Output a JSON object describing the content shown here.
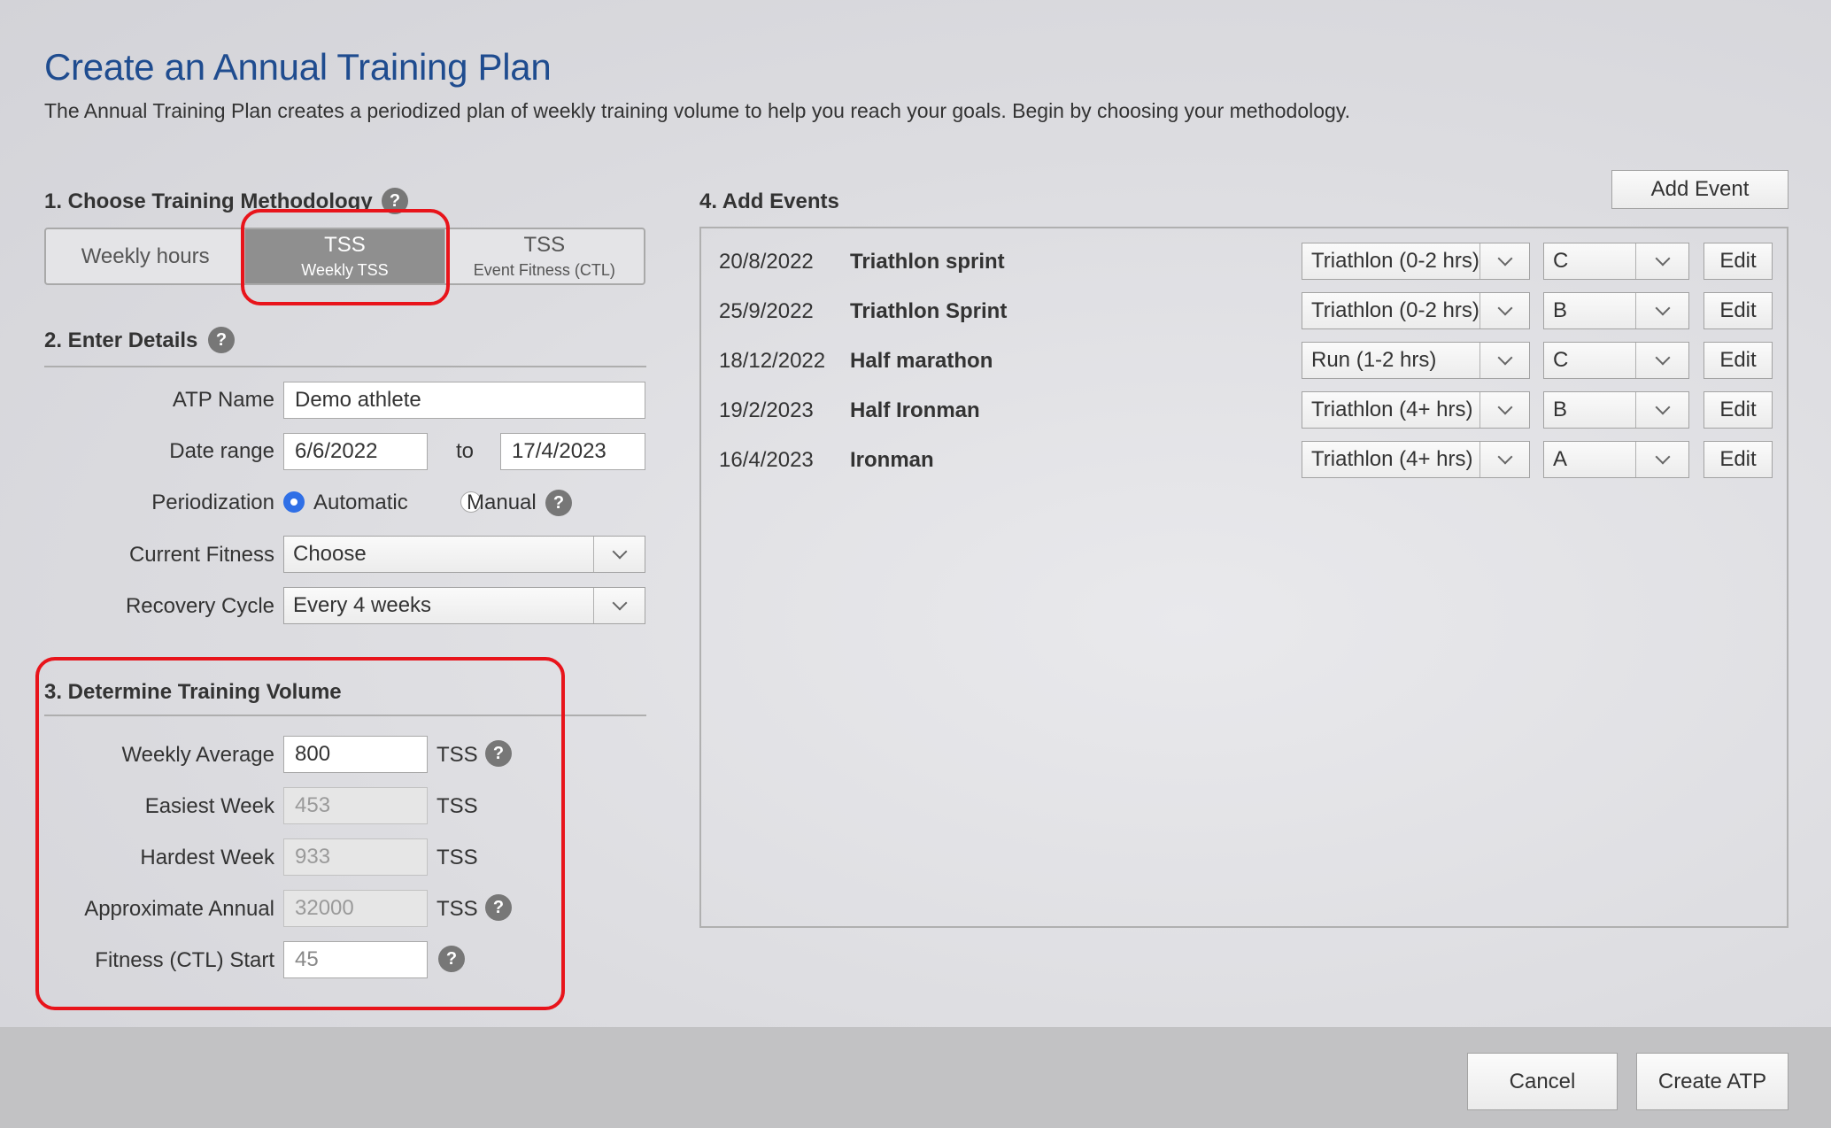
{
  "header": {
    "title": "Create an Annual Training Plan",
    "subtitle": "The Annual Training Plan creates a periodized plan of weekly training volume to help you reach your goals. Begin by choosing your methodology."
  },
  "methodology": {
    "heading": "1. Choose Training Methodology",
    "options": [
      {
        "main": "Weekly hours",
        "sub": "",
        "active": false
      },
      {
        "main": "TSS",
        "sub": "Weekly TSS",
        "active": true
      },
      {
        "main": "TSS",
        "sub": "Event Fitness (CTL)",
        "active": false
      }
    ]
  },
  "details": {
    "heading": "2. Enter Details",
    "atp_name_label": "ATP Name",
    "atp_name_value": "Demo athlete",
    "date_range_label": "Date range",
    "date_start": "6/6/2022",
    "date_to": "to",
    "date_end": "17/4/2023",
    "periodization_label": "Periodization",
    "periodization_options": [
      "Automatic",
      "Manual"
    ],
    "periodization_selected": "Automatic",
    "current_fitness_label": "Current Fitness",
    "current_fitness_value": "Choose",
    "recovery_cycle_label": "Recovery Cycle",
    "recovery_cycle_value": "Every 4 weeks"
  },
  "volume": {
    "heading": "3. Determine Training Volume",
    "unit": "TSS",
    "weekly_average_label": "Weekly Average",
    "weekly_average_value": "800",
    "easiest_week_label": "Easiest Week",
    "easiest_week_value": "453",
    "hardest_week_label": "Hardest Week",
    "hardest_week_value": "933",
    "approx_annual_label": "Approximate Annual",
    "approx_annual_value": "32000",
    "ctl_start_label": "Fitness (CTL) Start",
    "ctl_start_value": "45"
  },
  "events": {
    "heading": "4. Add Events",
    "add_button": "Add Event",
    "edit_label": "Edit",
    "rows": [
      {
        "date": "20/8/2022",
        "name": "Triathlon sprint",
        "type": "Triathlon (0-2 hrs)",
        "priority": "C"
      },
      {
        "date": "25/9/2022",
        "name": "Triathlon Sprint",
        "type": "Triathlon (0-2 hrs)",
        "priority": "B"
      },
      {
        "date": "18/12/2022",
        "name": "Half marathon",
        "type": "Run (1-2 hrs)",
        "priority": "C"
      },
      {
        "date": "19/2/2023",
        "name": "Half Ironman",
        "type": "Triathlon (4+ hrs)",
        "priority": "B"
      },
      {
        "date": "16/4/2023",
        "name": "Ironman",
        "type": "Triathlon (4+ hrs)",
        "priority": "A"
      }
    ]
  },
  "footer": {
    "cancel": "Cancel",
    "create": "Create ATP"
  },
  "help_glyph": "?",
  "colors": {
    "title": "#1f4c8f",
    "highlight": "#e8141b",
    "radio": "#2f6fe6",
    "active_segment": "#8f8f8f"
  }
}
